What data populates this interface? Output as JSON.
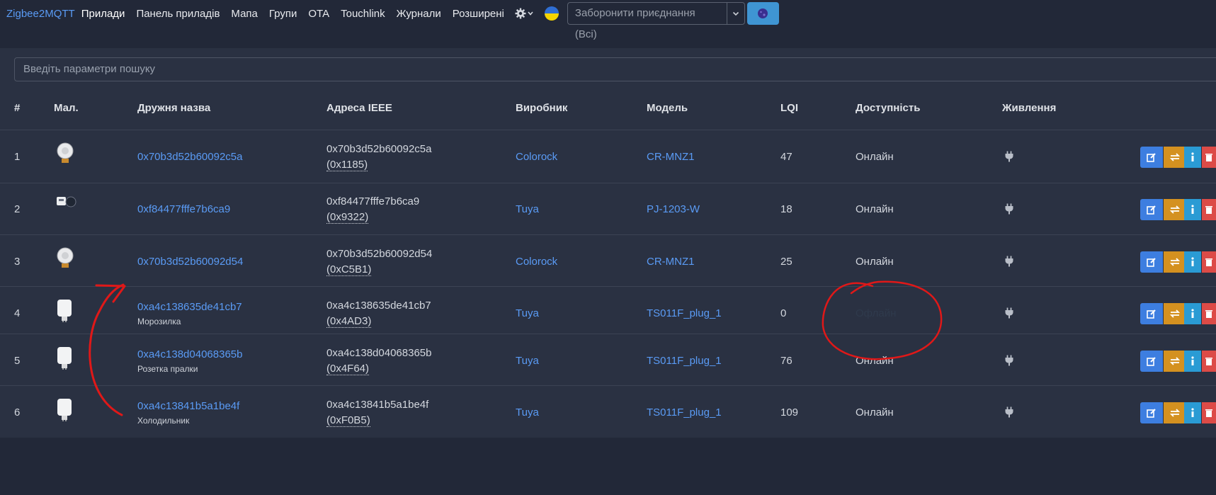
{
  "nav": {
    "brand": "Zigbee2MQTT",
    "links": [
      "Прилади",
      "Панель приладів",
      "Мапа",
      "Групи",
      "OTA",
      "Touchlink",
      "Журнали",
      "Розширені"
    ],
    "permit_join": "Заборонити приєднання (Всі)"
  },
  "search": {
    "placeholder": "Введіть параметри пошуку"
  },
  "table": {
    "headers": [
      "#",
      "Мал.",
      "Дружня назва",
      "Адреса IEEE",
      "Виробник",
      "Модель",
      "LQI",
      "Доступність",
      "Живлення"
    ],
    "rows": [
      {
        "num": "1",
        "name": "0x70b3d52b60092c5a",
        "desc": "",
        "ieee": "0x70b3d52b60092c5a",
        "nwk": "(0x1185)",
        "vendor": "Colorock",
        "model": "CR-MNZ1",
        "lqi": "47",
        "avail": "Онлайн",
        "image": "bulb-device"
      },
      {
        "num": "2",
        "name": "0xf84477fffe7b6ca9",
        "desc": "",
        "ieee": "0xf84477fffe7b6ca9",
        "nwk": "(0x9322)",
        "vendor": "Tuya",
        "model": "PJ-1203-W",
        "lqi": "18",
        "avail": "Онлайн",
        "image": "meter-device"
      },
      {
        "num": "3",
        "name": "0x70b3d52b60092d54",
        "desc": "",
        "ieee": "0x70b3d52b60092d54",
        "nwk": "(0xC5B1)",
        "vendor": "Colorock",
        "model": "CR-MNZ1",
        "lqi": "25",
        "avail": "Онлайн",
        "image": "bulb-device"
      },
      {
        "num": "4",
        "name": "0xa4c138635de41cb7",
        "desc": "Морозилка",
        "ieee": "0xa4c138635de41cb7",
        "nwk": "(0x4AD3)",
        "vendor": "Tuya",
        "model": "TS011F_plug_1",
        "lqi": "0",
        "avail": "Офлайн",
        "image": "plug-device"
      },
      {
        "num": "5",
        "name": "0xa4c138d04068365b",
        "desc": "Розетка пралки",
        "ieee": "0xa4c138d04068365b",
        "nwk": "(0x4F64)",
        "vendor": "Tuya",
        "model": "TS011F_plug_1",
        "lqi": "76",
        "avail": "Онлайн",
        "image": "plug-device"
      },
      {
        "num": "6",
        "name": "0xa4c13841b5a1be4f",
        "desc": "Холодильник",
        "ieee": "0xa4c13841b5a1be4f",
        "nwk": "(0xF0B5)",
        "vendor": "Tuya",
        "model": "TS011F_plug_1",
        "lqi": "109",
        "avail": "Онлайн",
        "image": "plug-device"
      }
    ]
  },
  "colors": {
    "link": "#5a9bf5",
    "edit": "#3d7ee0",
    "swap": "#d49120",
    "info": "#2a9bd4",
    "delete": "#dc4b47",
    "annotation": "#e01818"
  },
  "icons": [
    "gear-icon",
    "chevron-down-icon",
    "moon-icon",
    "plug-icon",
    "edit-icon",
    "swap-icon",
    "info-icon",
    "trash-icon"
  ]
}
